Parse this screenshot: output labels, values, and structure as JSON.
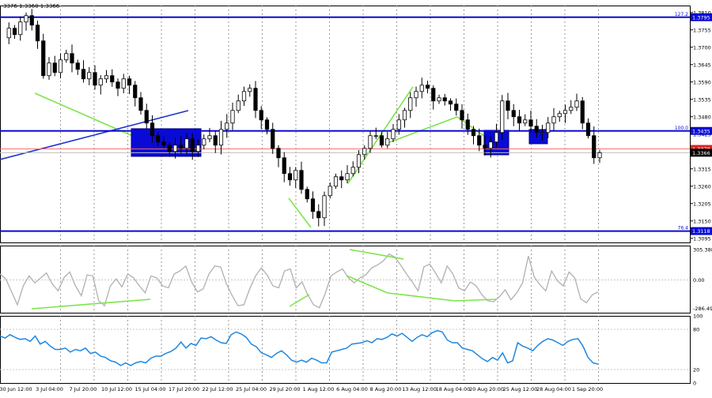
{
  "header": {
    "symbol_text": "3376 1.3360 1.3366"
  },
  "chart_data": [
    {
      "type": "candlestick",
      "panel": "price",
      "ylim": [
        1.3082,
        1.3832
      ],
      "y_ticks": [
        "1.3810",
        "1.3755",
        "1.3700",
        "1.3645",
        "1.3590",
        "1.3535",
        "1.3480",
        "1.3425",
        "1.3315",
        "1.3260",
        "1.3205",
        "1.3150",
        "1.3095"
      ],
      "x_tick_labels": [
        "30 Jun 12:00",
        "3 Jul 04:00",
        "7 Jul 20:00",
        "10 Jul 12:00",
        "15 Jul 04:00",
        "17 Jul 20:00",
        "22 Jul 12:00",
        "25 Jul 04:00",
        "29 Jul 20:00",
        "1 Aug 12:00",
        "6 Aug 04:00",
        "8 Aug 20:00",
        "13 Aug 12:00",
        "18 Aug 04:00",
        "20 Aug 20:00",
        "25 Aug 12:00",
        "28 Aug 04:00",
        "1 Sep 20:00"
      ],
      "close_path": [
        1.373,
        1.376,
        1.374,
        1.378,
        1.38,
        1.377,
        1.372,
        1.361,
        1.365,
        1.362,
        1.366,
        1.368,
        1.365,
        1.363,
        1.36,
        1.362,
        1.358,
        1.36,
        1.361,
        1.359,
        1.357,
        1.36,
        1.358,
        1.354,
        1.35,
        1.346,
        1.342,
        1.34,
        1.339,
        1.337,
        1.339,
        1.338,
        1.341,
        1.337,
        1.339,
        1.341,
        1.342,
        1.339,
        1.344,
        1.346,
        1.35,
        1.353,
        1.356,
        1.357,
        1.35,
        1.347,
        1.344,
        1.338,
        1.335,
        1.33,
        1.328,
        1.331,
        1.325,
        1.322,
        1.318,
        1.316,
        1.323,
        1.326,
        1.329,
        1.328,
        1.33,
        1.332,
        1.336,
        1.338,
        1.342,
        1.342,
        1.339,
        1.341,
        1.344,
        1.347,
        1.35,
        1.354,
        1.356,
        1.358,
        1.357,
        1.353,
        1.354,
        1.353,
        1.352,
        1.35,
        1.347,
        1.344,
        1.342,
        1.339,
        1.338,
        1.34,
        1.343,
        1.353,
        1.35,
        1.348,
        1.346,
        1.347,
        1.345,
        1.343,
        1.343,
        1.346,
        1.348,
        1.349,
        1.35,
        1.351,
        1.353,
        1.346,
        1.342,
        1.335,
        1.3366
      ],
      "horizontal_levels": [
        {
          "price": 1.3795,
          "label": "1.3795",
          "fib": "127.2",
          "color": "#0000cc"
        },
        {
          "price": 1.3435,
          "label": "1.3435",
          "fib": "100.0",
          "color": "#0000cc"
        },
        {
          "price": 1.3378,
          "label": "1.3378",
          "color": "#e02020"
        },
        {
          "price": 1.3366,
          "label": "1.3366",
          "color": "#000000"
        },
        {
          "price": 1.3118,
          "label": "1.3118",
          "fib": "76.4",
          "color": "#0000cc"
        }
      ]
    },
    {
      "type": "line",
      "panel": "cci",
      "ylim": [
        -330,
        345
      ],
      "y_ticks": [
        "305.3886",
        "0.00",
        "-286.493"
      ],
      "series": [
        {
          "values": [
            60,
            10,
            -120,
            -250,
            -60,
            40,
            -30,
            20,
            70,
            -40,
            -110,
            20,
            80,
            -60,
            -160,
            50,
            40,
            -210,
            -260,
            -60,
            10,
            -70,
            60,
            20,
            -60,
            -130,
            40,
            20,
            -60,
            -80,
            60,
            90,
            140,
            -20,
            -120,
            -90,
            60,
            140,
            130,
            -40,
            -160,
            -260,
            -250,
            -90,
            40,
            120,
            50,
            -60,
            -80,
            90,
            110,
            -80,
            -20,
            -150,
            -250,
            -280,
            -140,
            40,
            80,
            110,
            20,
            -30,
            20,
            50,
            120,
            150,
            190,
            260,
            230,
            150,
            60,
            -20,
            -110,
            130,
            160,
            70,
            -30,
            140,
            60,
            -80,
            -110,
            -20,
            -60,
            -150,
            -210,
            -220,
            -170,
            -100,
            -200,
            -130,
            -30,
            240,
            30,
            -50,
            -110,
            90,
            -10,
            -60,
            80,
            20,
            -190,
            -230,
            -150,
            -120
          ]
        }
      ]
    },
    {
      "type": "line",
      "panel": "rsi",
      "ylim": [
        0,
        100
      ],
      "y_ticks": [
        "100",
        "80",
        "20",
        "0"
      ],
      "series": [
        {
          "values": [
            70,
            67,
            72,
            68,
            65,
            66,
            62,
            70,
            58,
            62,
            55,
            50,
            50,
            52,
            46,
            50,
            48,
            52,
            44,
            46,
            40,
            38,
            33,
            31,
            26,
            30,
            26,
            30,
            32,
            30,
            37,
            40,
            40,
            44,
            47,
            52,
            61,
            52,
            59,
            56,
            67,
            66,
            69,
            64,
            60,
            59,
            72,
            76,
            73,
            68,
            58,
            54,
            45,
            42,
            38,
            44,
            48,
            42,
            34,
            31,
            34,
            31,
            37,
            34,
            30,
            30,
            46,
            48,
            50,
            52,
            58,
            59,
            60,
            63,
            60,
            66,
            65,
            68,
            73,
            70,
            74,
            68,
            62,
            68,
            72,
            69,
            75,
            78,
            76,
            64,
            60,
            60,
            52,
            50,
            48,
            42,
            36,
            32,
            38,
            34,
            45,
            30,
            33,
            60,
            55,
            52,
            48,
            56,
            62,
            66,
            64,
            60,
            56,
            62,
            65,
            66,
            55,
            38,
            30,
            28
          ]
        }
      ]
    }
  ]
}
